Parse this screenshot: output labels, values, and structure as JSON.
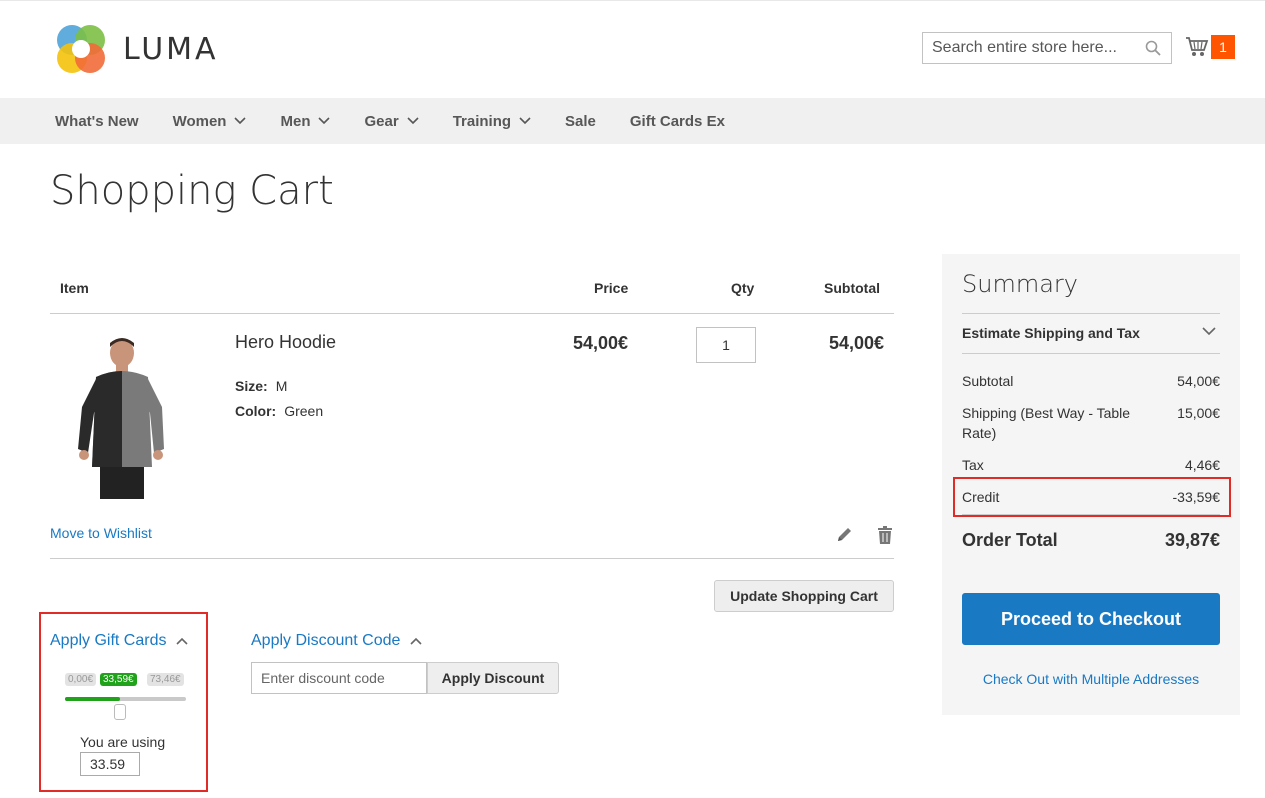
{
  "header": {
    "logo_text": "LUMA",
    "search_placeholder": "Search entire store here...",
    "cart_count": "1"
  },
  "nav": {
    "items": [
      {
        "label": "What's New",
        "has_dropdown": false
      },
      {
        "label": "Women",
        "has_dropdown": true
      },
      {
        "label": "Men",
        "has_dropdown": true
      },
      {
        "label": "Gear",
        "has_dropdown": true
      },
      {
        "label": "Training",
        "has_dropdown": true
      },
      {
        "label": "Sale",
        "has_dropdown": false
      },
      {
        "label": "Gift Cards Ex",
        "has_dropdown": false
      }
    ]
  },
  "page": {
    "title": "Shopping Cart"
  },
  "cart": {
    "columns": {
      "item": "Item",
      "price": "Price",
      "qty": "Qty",
      "subtotal": "Subtotal"
    },
    "items": [
      {
        "name": "Hero Hoodie",
        "options": [
          {
            "label": "Size:",
            "value": "M"
          },
          {
            "label": "Color:",
            "value": "Green"
          }
        ],
        "price": "54,00€",
        "qty": "1",
        "subtotal": "54,00€"
      }
    ],
    "move_to_wishlist": "Move to Wishlist",
    "update_button": "Update Shopping Cart"
  },
  "gift_cards": {
    "title": "Apply Gift Cards",
    "slider": {
      "min_label": "0,00€",
      "current_label": "33,59€",
      "max_label": "73,46€",
      "fraction": 0.457
    },
    "using_label": "You are using",
    "using_value": "33.59"
  },
  "discount": {
    "title": "Apply Discount Code",
    "placeholder": "Enter discount code",
    "button": "Apply Discount"
  },
  "summary": {
    "title": "Summary",
    "estimate": "Estimate Shipping and Tax",
    "rows": [
      {
        "label": "Subtotal",
        "value": "54,00€"
      },
      {
        "label": "Shipping (Best Way - Table Rate)",
        "value": "15,00€"
      },
      {
        "label": "Tax",
        "value": "4,46€"
      },
      {
        "label": "Credit",
        "value": "-33,59€"
      }
    ],
    "order_total_label": "Order Total",
    "order_total_value": "39,87€",
    "checkout_button": "Proceed to Checkout",
    "multi_address": "Check Out with Multiple Addresses"
  },
  "colors": {
    "accent": "#1979c3",
    "badge": "#ff5501",
    "highlight": "#e02b27",
    "slider_fill": "#21a21b"
  }
}
